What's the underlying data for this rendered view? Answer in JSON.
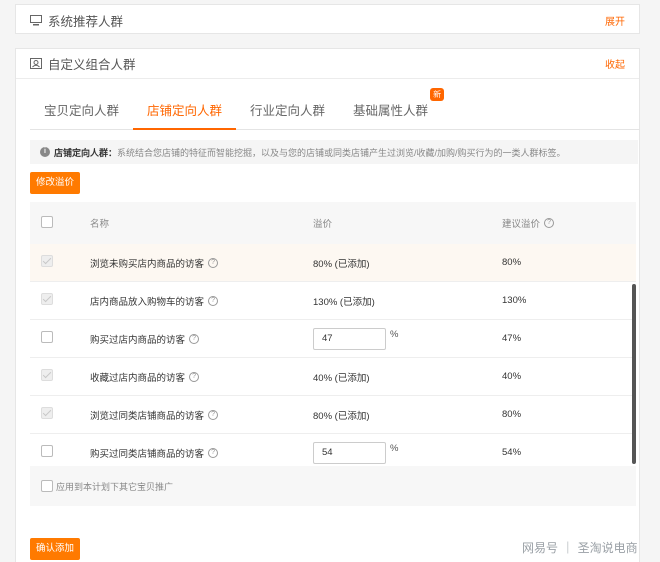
{
  "panel1": {
    "title": "系统推荐人群",
    "toggle": "展开",
    "icon": "monitor-icon"
  },
  "panel2": {
    "title": "自定义组合人群",
    "toggle": "收起",
    "icon": "custom-group-icon"
  },
  "tabs": [
    {
      "label": "宝贝定向人群"
    },
    {
      "label": "店铺定向人群",
      "active": true
    },
    {
      "label": "行业定向人群"
    },
    {
      "label": "基础属性人群",
      "badge": "新"
    }
  ],
  "info": {
    "icon_text": "i",
    "title": "店铺定向人群：",
    "text": "系统结合您店铺的特征而智能挖掘，以及与您的店铺或同类店铺产生过浏览/收藏/加购/购买行为的一类人群标签。"
  },
  "edit_button": "修改溢价",
  "table": {
    "headers": {
      "name": "名称",
      "bid": "溢价",
      "suggest": "建议溢价"
    },
    "rows": [
      {
        "name": "浏览未购买店内商品的访客",
        "bid": "80% (已添加)",
        "suggest": "80%"
      },
      {
        "name": "店内商品放入购物车的访客",
        "bid": "130% (已添加)",
        "suggest": "130%"
      },
      {
        "name": "购买过店内商品的访客",
        "bid_input": "47",
        "pct": "%",
        "suggest": "47%"
      },
      {
        "name": "收藏过店内商品的访客",
        "bid": "40% (已添加)",
        "suggest": "40%"
      },
      {
        "name": "浏览过同类店铺商品的访客",
        "bid": "80% (已添加)",
        "suggest": "80%"
      },
      {
        "name": "购买过同类店铺商品的访客",
        "bid_input": "54",
        "pct": "%",
        "suggest": "54%"
      }
    ]
  },
  "apply_label": "应用到本计划下其它宝贝推广",
  "confirm_button": "确认添加",
  "watermark": "网易号 ｜ 圣淘说电商",
  "colors": {
    "accent": "#ff6600"
  }
}
